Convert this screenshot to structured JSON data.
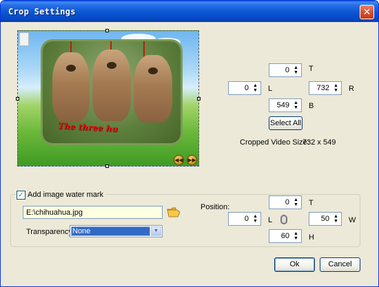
{
  "window": {
    "title": "Crop Settings"
  },
  "crop": {
    "top": "0",
    "left": "0",
    "right": "732",
    "bottom": "549",
    "labels": {
      "top": "T",
      "left": "L",
      "right": "R",
      "bottom": "B"
    },
    "select_all_label": "Select All",
    "size_caption": "Cropped Video Size:",
    "size_value": "732 x 549"
  },
  "preview": {
    "watermark_text": "The three hu"
  },
  "watermark": {
    "checkbox_label": "Add image water mark",
    "checked": true,
    "image_path": "E:\\chihuahua.jpg",
    "transparency_label": "Transparency:",
    "transparency_value": "None",
    "position_label": "Position:",
    "top": "0",
    "left": "0",
    "width": "50",
    "height": "60",
    "labels": {
      "top": "T",
      "left": "L",
      "width": "W",
      "height": "H"
    }
  },
  "buttons": {
    "ok": "Ok",
    "cancel": "Cancel"
  },
  "icons": {
    "close": "close-icon",
    "folder": "folder-open-icon",
    "lock": "chain-link-icon",
    "prev": "rewind-icon",
    "next": "forward-icon"
  }
}
